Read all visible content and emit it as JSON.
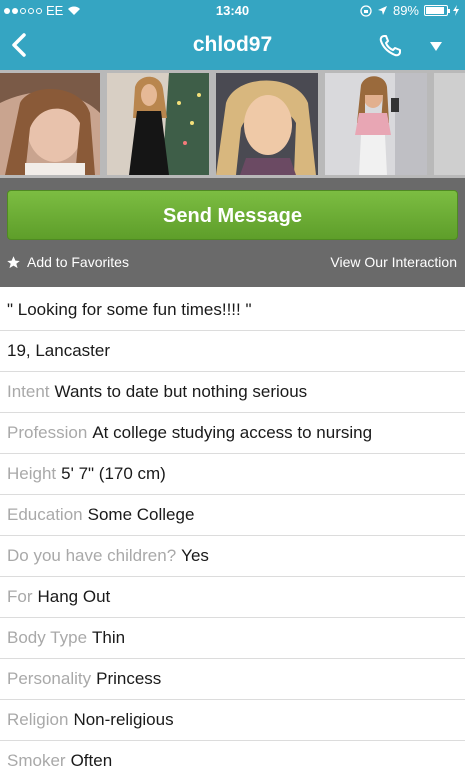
{
  "status_bar": {
    "carrier": "EE",
    "time": "13:40",
    "battery": "89%",
    "battery_level": 0.89
  },
  "nav": {
    "title": "chlod97"
  },
  "actions": {
    "send_message": "Send Message",
    "add_favorites": "Add to Favorites",
    "view_interaction": "View Our Interaction"
  },
  "profile": {
    "headline": "\" Looking for some fun times!!!! \"",
    "age_location": "19, Lancaster",
    "fields": [
      {
        "label": "Intent",
        "value": "Wants to date but nothing serious"
      },
      {
        "label": "Profession",
        "value": "At college studying access to nursing"
      },
      {
        "label": "Height",
        "value": "5' 7\" (170 cm)"
      },
      {
        "label": "Education",
        "value": "Some College"
      },
      {
        "label": "Do you have children?",
        "value": "Yes"
      },
      {
        "label": "For",
        "value": "Hang Out"
      },
      {
        "label": "Body Type",
        "value": "Thin"
      },
      {
        "label": "Personality",
        "value": "Princess"
      },
      {
        "label": "Religion",
        "value": "Non-religious"
      },
      {
        "label": "Smoker",
        "value": "Often"
      }
    ]
  },
  "colors": {
    "header": "#35a5c2",
    "send_button": "#6aab33",
    "action_panel": "#6a6a6a",
    "field_label": "#a9a9a9"
  }
}
